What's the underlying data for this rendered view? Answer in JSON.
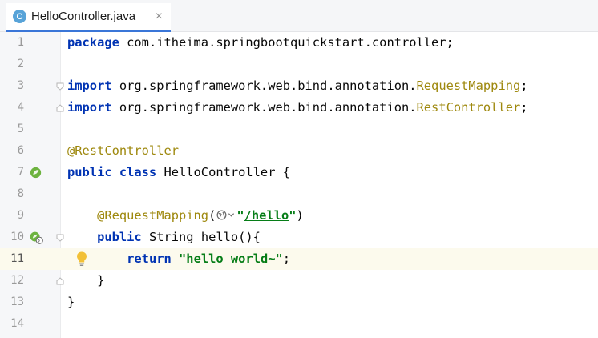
{
  "tab": {
    "icon_letter": "C",
    "filename": "HelloController.java",
    "close_glyph": "×"
  },
  "colors": {
    "keyword": "#0033b3",
    "annotation": "#9e880d",
    "string": "#067d17",
    "current_line": "#fcfaed",
    "spring_icon": "#6db33f"
  },
  "lines": [
    {
      "num": "1",
      "tokens": [
        [
          "kw",
          "package"
        ],
        [
          "plain",
          " com.itheima.springbootquickstart.controller;"
        ]
      ]
    },
    {
      "num": "2",
      "tokens": []
    },
    {
      "num": "3",
      "tokens": [
        [
          "kw",
          "import"
        ],
        [
          "plain",
          " org.springframework.web.bind.annotation."
        ],
        [
          "ann",
          "RequestMapping"
        ],
        [
          "plain",
          ";"
        ]
      ]
    },
    {
      "num": "4",
      "tokens": [
        [
          "kw",
          "import"
        ],
        [
          "plain",
          " org.springframework.web.bind.annotation."
        ],
        [
          "ann",
          "RestController"
        ],
        [
          "plain",
          ";"
        ]
      ]
    },
    {
      "num": "5",
      "tokens": []
    },
    {
      "num": "6",
      "tokens": [
        [
          "ann",
          "@RestController"
        ]
      ]
    },
    {
      "num": "7",
      "tokens": [
        [
          "kw",
          "public class"
        ],
        [
          "plain",
          " HelloController {"
        ]
      ]
    },
    {
      "num": "8",
      "tokens": []
    },
    {
      "num": "9",
      "tokens": [
        [
          "plain",
          "    "
        ],
        [
          "ann",
          "@RequestMapping"
        ],
        [
          "plain",
          "("
        ],
        [
          "globe",
          ""
        ],
        [
          "caret",
          ""
        ],
        [
          "str",
          "\""
        ],
        [
          "strU",
          "/hello"
        ],
        [
          "str",
          "\""
        ],
        [
          "plain",
          ")"
        ]
      ]
    },
    {
      "num": "10",
      "tokens": [
        [
          "plain",
          "    "
        ],
        [
          "kw",
          "public"
        ],
        [
          "plain",
          " String hello(){"
        ]
      ]
    },
    {
      "num": "11",
      "tokens": [
        [
          "plain",
          "        "
        ],
        [
          "kw",
          "return"
        ],
        [
          "plain",
          " "
        ],
        [
          "str",
          "\"hello world~\""
        ],
        [
          "plain",
          ";"
        ]
      ]
    },
    {
      "num": "12",
      "tokens": [
        [
          "plain",
          "    }"
        ]
      ]
    },
    {
      "num": "13",
      "tokens": [
        [
          "plain",
          "}"
        ]
      ]
    },
    {
      "num": "14",
      "tokens": []
    }
  ],
  "current_line": "11",
  "gutter_icons": {
    "7": "spring-bean-icon",
    "10": "spring-web-endpoint-icon",
    "11": "intention-bulb-icon"
  }
}
